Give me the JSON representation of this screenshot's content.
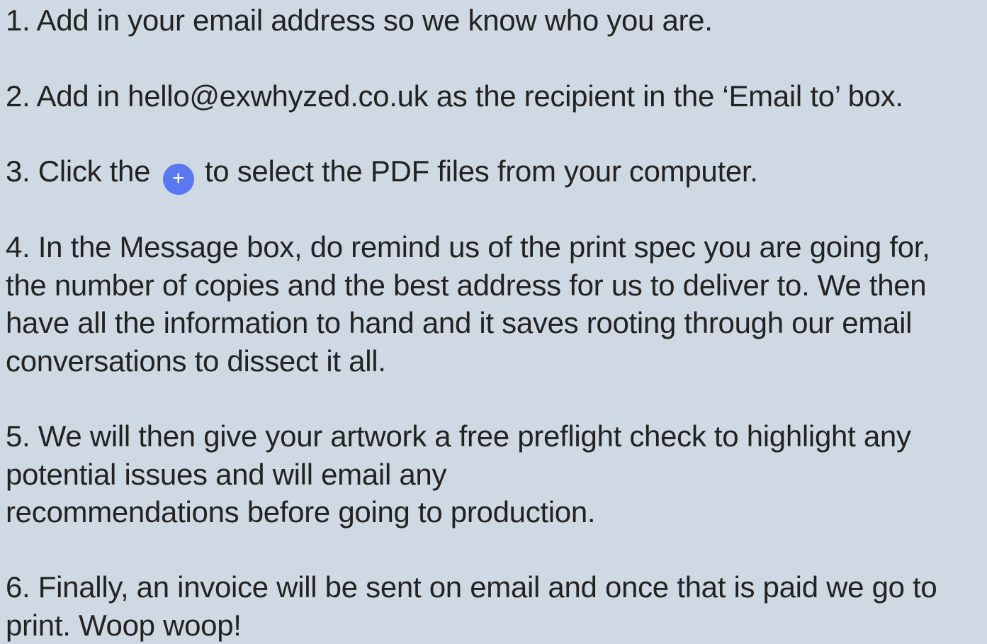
{
  "steps": [
    {
      "lines": [
        "1. Add in your email address so we know who you are."
      ]
    },
    {
      "lines": [
        "2. Add in hello@exwhyzed.co.uk as the recipient in the ‘Email to’ box."
      ]
    },
    {
      "before_icon": "3. Click the",
      "icon": "plus-icon",
      "icon_glyph": "+",
      "after_icon": "to select the PDF files from your computer."
    },
    {
      "lines": [
        "4. In the Message box, do remind us of the print spec you are going for,",
        "the number of copies and the best address for us to deliver to. We then",
        "have all the information to hand and it saves rooting through our email",
        "conversations to dissect it all."
      ]
    },
    {
      "lines": [
        "5. We will then give your artwork a free preflight check to highlight any",
        "potential issues and will email any",
        "recommendations before going to production."
      ]
    },
    {
      "lines": [
        "6. Finally, an invoice will be sent on email and once that is paid we go to",
        "print. Woop woop!"
      ]
    }
  ],
  "colors": {
    "background": "#cfd9e3",
    "text": "#222222",
    "icon_accent": "#5a78f0"
  }
}
